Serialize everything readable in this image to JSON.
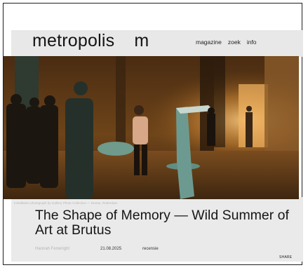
{
  "header": {
    "logo_left": "metropolis",
    "logo_right": "m",
    "nav": [
      "magazine",
      "zoek",
      "info"
    ]
  },
  "hero": {
    "caption": "Installation photograph by Gallery Photo Collective — Brutus, Rotterdam"
  },
  "article": {
    "title": "The Shape of Memory — Wild Summer of Art at Brutus",
    "author": "Hannah Fenwright",
    "date": "21.08.2025",
    "category": "recensie",
    "share_label": "SHARE"
  },
  "colors": {
    "background": "#ffffff",
    "panel": "#eaeaea",
    "text": "#161616",
    "hero_warm": "#c9863b"
  }
}
